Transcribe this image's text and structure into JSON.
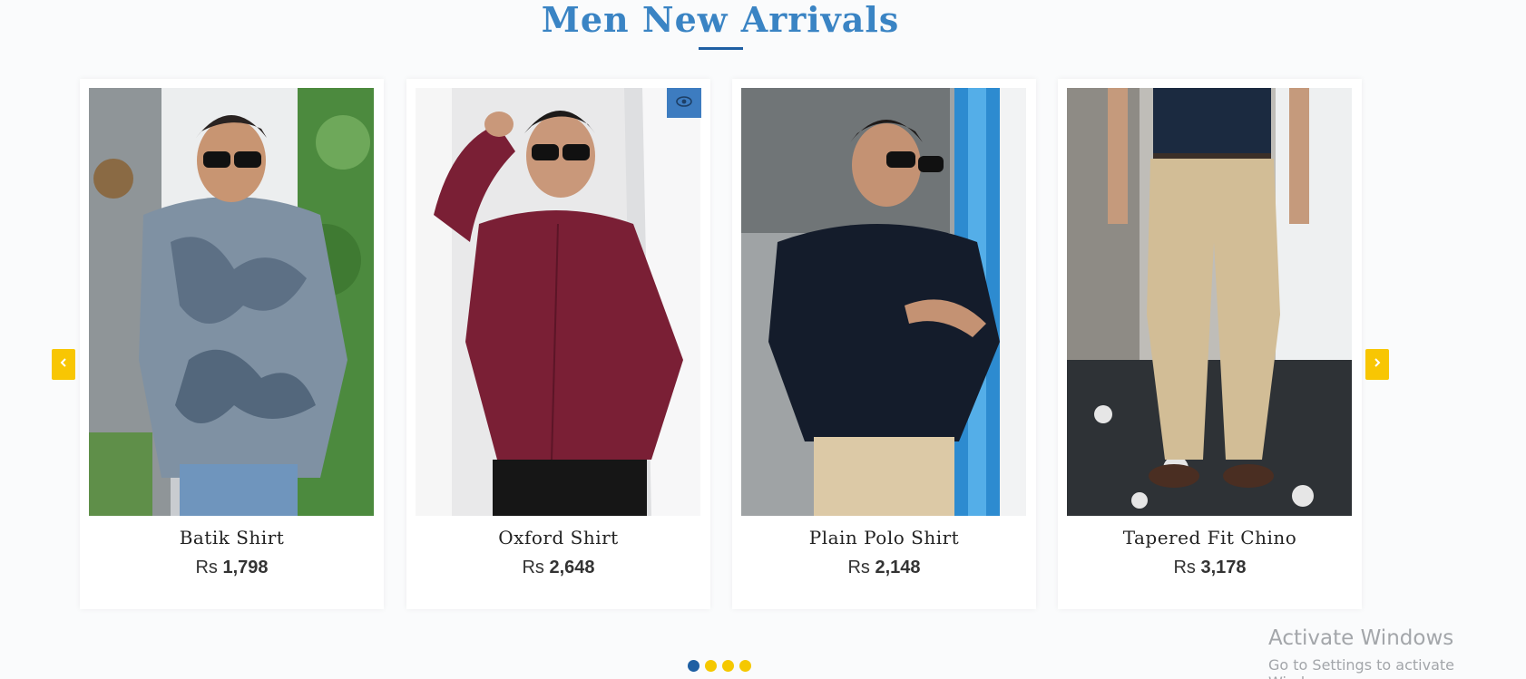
{
  "section": {
    "title": "Men New Arrivals"
  },
  "products": [
    {
      "name": "Batik Shirt",
      "currency": "Rs",
      "price": "1,798"
    },
    {
      "name": "Oxford Shirt",
      "currency": "Rs",
      "price": "2,648"
    },
    {
      "name": "Plain Polo Shirt",
      "currency": "Rs",
      "price": "2,148"
    },
    {
      "name": "Tapered Fit Chino",
      "currency": "Rs",
      "price": "3,178"
    }
  ],
  "carousel": {
    "prev_icon": "chevron-left-icon",
    "next_icon": "chevron-right-icon",
    "quickview_icon": "eye-icon",
    "dots_count": 4,
    "active_dot": 1
  },
  "colors": {
    "title": "#3a84c4",
    "accent_blue": "#1e5fa3",
    "arrow_yellow": "#f8c603",
    "quickview_blue": "#3d7cc0"
  },
  "os_watermark": {
    "title": "Activate Windows",
    "subtitle": "Go to Settings to activate Windows."
  }
}
